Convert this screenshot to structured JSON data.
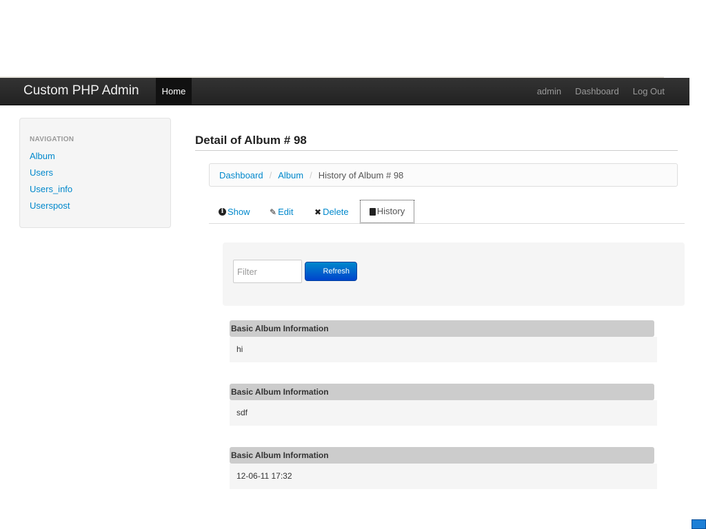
{
  "navbar": {
    "brand": "Custom PHP Admin",
    "home": "Home",
    "right_links": [
      "admin",
      "Dashboard",
      "Log Out"
    ]
  },
  "sidebar": {
    "header": "NAVIGATION",
    "items": [
      "Album",
      "Users",
      "Users_info",
      "Userspost"
    ]
  },
  "page": {
    "title": "Detail of Album # 98"
  },
  "breadcrumb": {
    "items": [
      "Dashboard",
      "Album"
    ],
    "active": "History of Album # 98",
    "separator": "/"
  },
  "tabs": {
    "show": "Show",
    "edit": "Edit",
    "delete": "Delete",
    "history": "History"
  },
  "filter": {
    "placeholder": "Filter",
    "refresh_label": "Refresh"
  },
  "history": [
    {
      "heading": "Basic Album Information",
      "value": "hi"
    },
    {
      "heading": "Basic Album Information",
      "value": "sdf"
    },
    {
      "heading": "Basic Album Information",
      "value": "12-06-11 17:32"
    }
  ],
  "colors": {
    "link": "#0088cc",
    "navbar": "#222222",
    "primary_button": "#0055cc"
  }
}
